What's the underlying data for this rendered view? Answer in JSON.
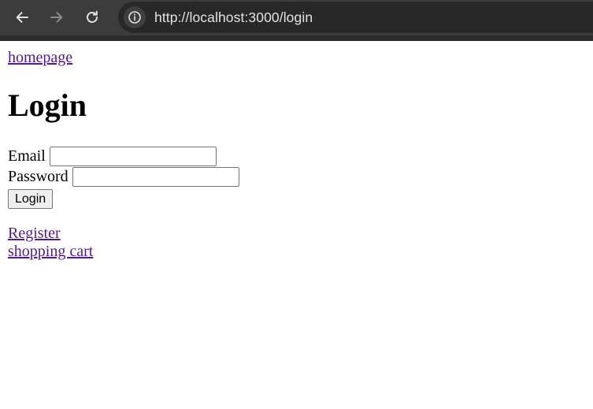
{
  "browser": {
    "url": "http://localhost:3000/login",
    "icons": {
      "back": "back-arrow-icon",
      "forward": "forward-arrow-icon",
      "reload": "reload-icon",
      "site_info": "info-icon"
    },
    "colors": {
      "toolbar": "#3c3c3c",
      "omnibox": "#282828",
      "text": "#e3e3e3"
    }
  },
  "page": {
    "home_link": "homepage",
    "title": "Login",
    "form": {
      "email_label": "Email",
      "email_value": "",
      "password_label": "Password",
      "password_value": "",
      "submit_label": "Login"
    },
    "register_link": "Register",
    "cart_link": "shopping cart",
    "colors": {
      "visited_link": "#551a8b"
    }
  }
}
